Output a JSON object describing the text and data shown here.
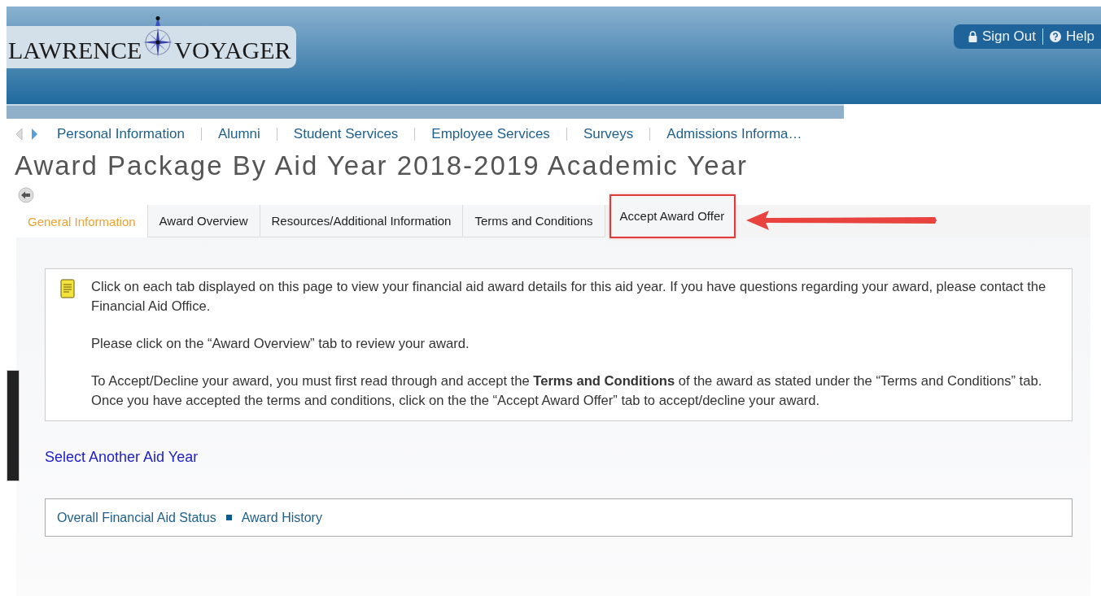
{
  "header": {
    "logo_left": "LAWRENCE",
    "logo_right": "VOYAGER",
    "sign_out": "Sign Out",
    "help": "Help"
  },
  "nav": [
    {
      "label": "Personal Information"
    },
    {
      "label": "Alumni"
    },
    {
      "label": "Student Services"
    },
    {
      "label": "Employee Services"
    },
    {
      "label": "Surveys"
    },
    {
      "label": "Admissions Informa…"
    }
  ],
  "page_title": "Award Package By Aid Year 2018-2019 Academic Year",
  "tabs": [
    {
      "label": "General Information",
      "selected": true,
      "highlighted": false
    },
    {
      "label": "Award Overview",
      "selected": false,
      "highlighted": false
    },
    {
      "label": "Resources/Additional Information",
      "selected": false,
      "highlighted": false
    },
    {
      "label": "Terms and Conditions",
      "selected": false,
      "highlighted": false
    },
    {
      "label": "Accept Award Offer",
      "selected": false,
      "highlighted": true
    }
  ],
  "info_paragraphs": [
    "Click on each tab displayed on this page to view your financial aid award details for this aid year. If you have questions regarding your award, please contact the Financial Aid Office.",
    "Please click on the “Award Overview” tab to review your award.",
    "To Accept/Decline your award, you must first read through and accept the **Terms and Conditions** of the award as stated under the “Terms and Conditions” tab. Once you have accepted the terms and conditions, click on the the “Accept Award Offer” tab to accept/decline your award."
  ],
  "select_link": "Select Another Aid Year",
  "footer_links": [
    {
      "label": "Overall Financial Aid Status"
    },
    {
      "label": "Award History"
    }
  ]
}
